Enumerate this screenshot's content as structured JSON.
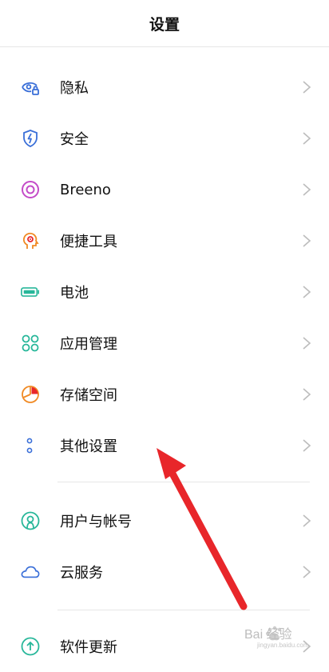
{
  "header": {
    "title": "设置"
  },
  "group1": [
    {
      "label": "隐私",
      "icon": "privacy-eye-lock-icon"
    },
    {
      "label": "安全",
      "icon": "security-shield-icon"
    },
    {
      "label": "Breeno",
      "icon": "breeno-ring-icon"
    },
    {
      "label": "便捷工具",
      "icon": "convenience-head-icon"
    },
    {
      "label": "电池",
      "icon": "battery-icon"
    },
    {
      "label": "应用管理",
      "icon": "apps-grid-icon"
    },
    {
      "label": "存储空间",
      "icon": "storage-pie-icon"
    },
    {
      "label": "其他设置",
      "icon": "other-settings-dots-icon"
    }
  ],
  "group2": [
    {
      "label": "用户与帐号",
      "icon": "user-account-icon"
    },
    {
      "label": "云服务",
      "icon": "cloud-icon"
    }
  ],
  "group3": [
    {
      "label": "软件更新",
      "icon": "software-update-icon"
    }
  ],
  "colors": {
    "blue": "#3a6fd8",
    "purple": "#c44bc8",
    "orange": "#f08a24",
    "green": "#28b79a",
    "red_arrow": "#e8262a"
  },
  "watermark": {
    "text": "Bai 经验",
    "subtext": "jingyan.baidu.com"
  }
}
